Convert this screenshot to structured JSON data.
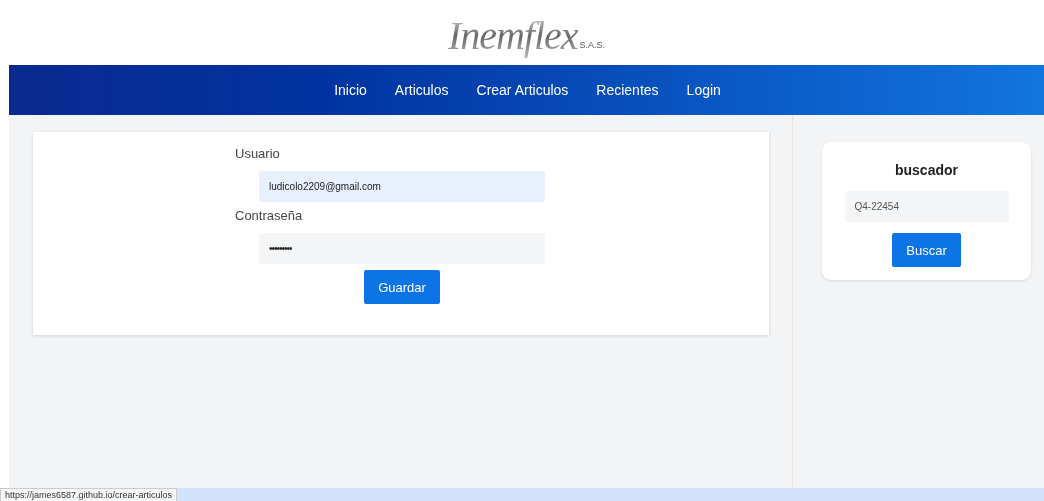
{
  "logo": {
    "name": "Inemflex",
    "suffix": "S.A.S."
  },
  "nav": [
    {
      "label": "Inicio"
    },
    {
      "label": "Articulos"
    },
    {
      "label": "Crear Articulos"
    },
    {
      "label": "Recientes"
    },
    {
      "label": "Login"
    }
  ],
  "form": {
    "fields": [
      {
        "label": "Usuario",
        "value": "ludicolo2209@gmail.com",
        "kind": "text",
        "autofilled": true
      },
      {
        "label": "Contraseña",
        "value": "•••••••••",
        "kind": "password",
        "autofilled": false
      }
    ],
    "button": "Guardar"
  },
  "sidebar": {
    "title": "buscador",
    "search": {
      "placeholder": "Q4-22454"
    },
    "button": "Buscar"
  },
  "status_bar": {
    "url": "https://james6587.github.io/crear-articulos"
  }
}
